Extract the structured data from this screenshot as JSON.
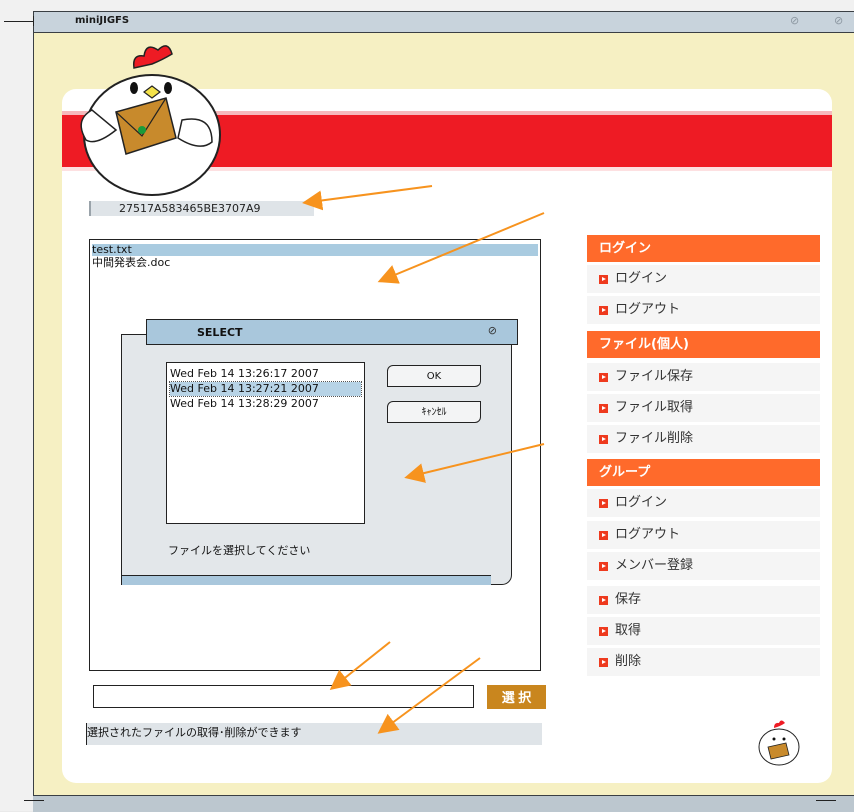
{
  "window": {
    "title": "miniJIGFS",
    "btn1": "⊘",
    "btn2": "⊘"
  },
  "card": {
    "session_id": "27517A583465BE3707A9"
  },
  "files": [
    {
      "name": "test.txt",
      "selected": true
    },
    {
      "name": "中間発表会.doc",
      "selected": false
    }
  ],
  "dialog": {
    "title": "SELECT",
    "close_icon": "⊘",
    "versions": [
      {
        "label": "Wed Feb 14 13:26:17 2007",
        "selected": false
      },
      {
        "label": "Wed Feb 14 13:27:21 2007",
        "selected": true
      },
      {
        "label": "Wed Feb 14 13:28:29 2007",
        "selected": false
      }
    ],
    "ok_label": "OK",
    "cancel_label": "ｷｬﾝｾﾙ",
    "message": "ファイルを選択してください"
  },
  "file_input": {
    "value": ""
  },
  "select_label": "選 択",
  "status_text": "選択されたファイルの取得･削除ができます",
  "sidebar": {
    "sections": [
      {
        "title": "ログイン",
        "items": [
          "ログイン",
          "ログアウト"
        ]
      },
      {
        "title": "ファイル(個人)",
        "items": [
          "ファイル保存",
          "ファイル取得",
          "ファイル削除"
        ]
      },
      {
        "title": "グループ",
        "items": [
          "ログイン",
          "ログアウト",
          "メンバー登録",
          "保存",
          "取得",
          "削除"
        ]
      }
    ]
  },
  "colors": {
    "accent": "#ff6a2b",
    "red_band": "#ee1b24",
    "select_button": "#c9861e",
    "list_highlight": "#a9cbe0",
    "annotation_arrow": "#f7931e"
  }
}
